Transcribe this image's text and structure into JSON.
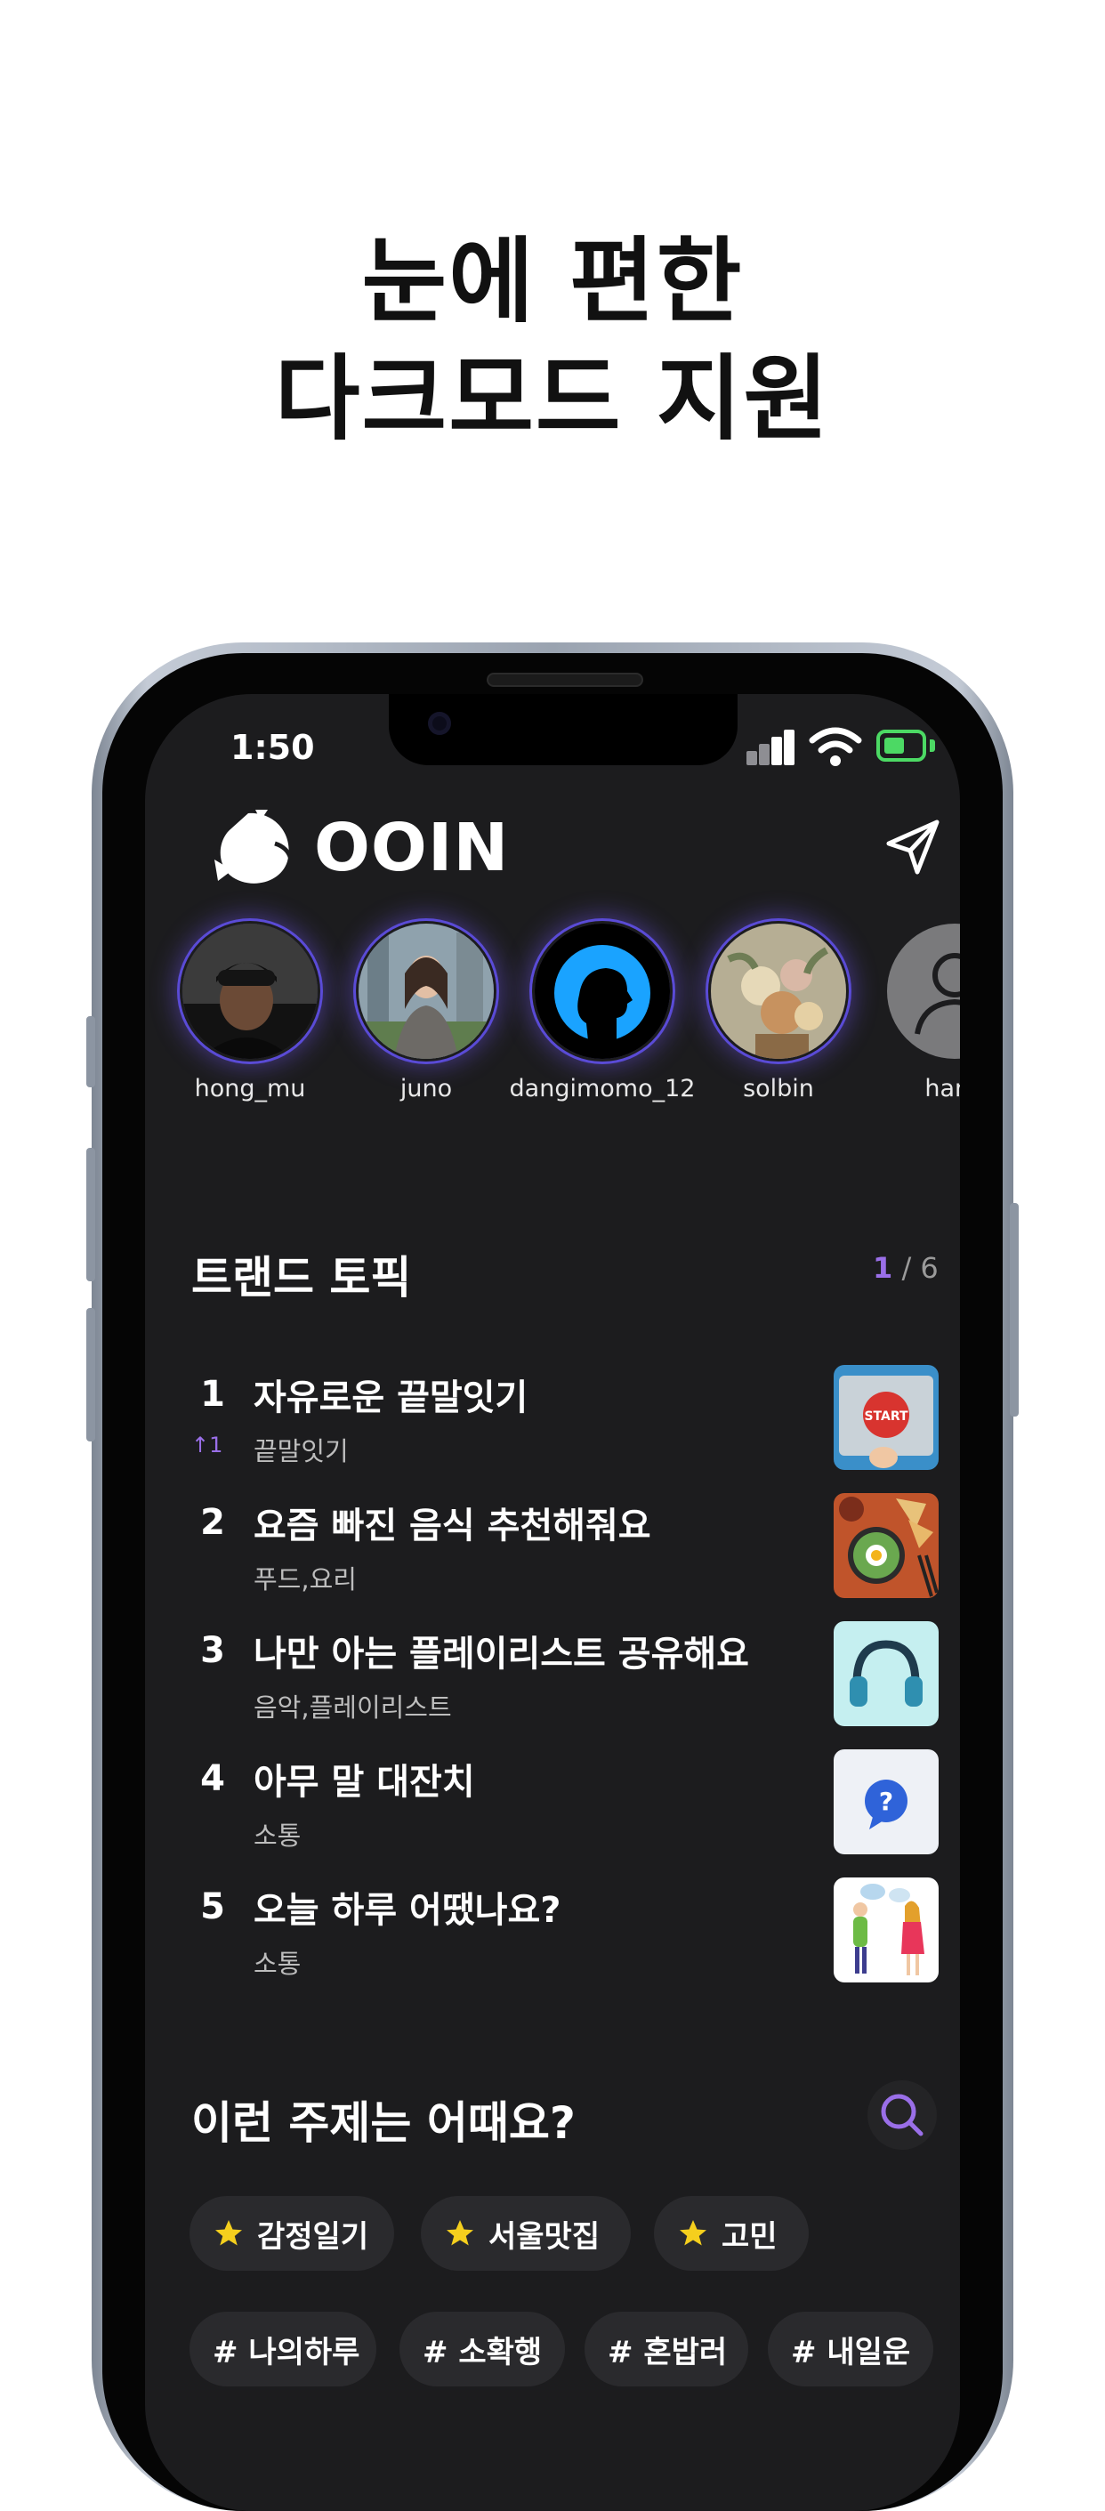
{
  "headline": {
    "line1": "눈에 편한",
    "line2": "다크모드 지원"
  },
  "status_bar": {
    "time": "1:50"
  },
  "app": {
    "brand": "OOIN"
  },
  "stories": [
    {
      "name": "hong_mu"
    },
    {
      "name": "juno"
    },
    {
      "name": "dangimomo_12"
    },
    {
      "name": "solbin"
    },
    {
      "name": "hana"
    }
  ],
  "trend": {
    "title": "트랜드 토픽",
    "page_current": "1",
    "page_total": "/ 6",
    "topics": [
      {
        "rank": "1",
        "title": "자유로운 끝말잇기",
        "tag": "끝말잇기",
        "movement": "↑1",
        "thumb": "start-button-image"
      },
      {
        "rank": "2",
        "title": "요즘 빠진 음식 추천해줘요",
        "tag": "푸드,요리",
        "thumb": "food-image"
      },
      {
        "rank": "3",
        "title": "나만 아는 플레이리스트 공유해요",
        "tag": "음악,플레이리스트",
        "thumb": "headphones-image"
      },
      {
        "rank": "4",
        "title": "아무 말 대잔치",
        "tag": "소통",
        "thumb": "question-bubble-image"
      },
      {
        "rank": "5",
        "title": "오늘 하루 어땠나요?",
        "tag": "소통",
        "thumb": "people-chatting-image"
      }
    ]
  },
  "suggest": {
    "title": "이런 주제는 어때요?",
    "featured": [
      "감정일기",
      "서울맛집",
      "고민"
    ],
    "hashtags": [
      "# 나의하루",
      "# 소확행",
      "# 혼밥러",
      "# 내일운"
    ]
  },
  "colors": {
    "accent": "#9a6fe8",
    "screen_bg": "#1c1c1e",
    "chip_bg": "#2a2a2d",
    "battery": "#4cd964",
    "star": "#f5cf1d"
  }
}
